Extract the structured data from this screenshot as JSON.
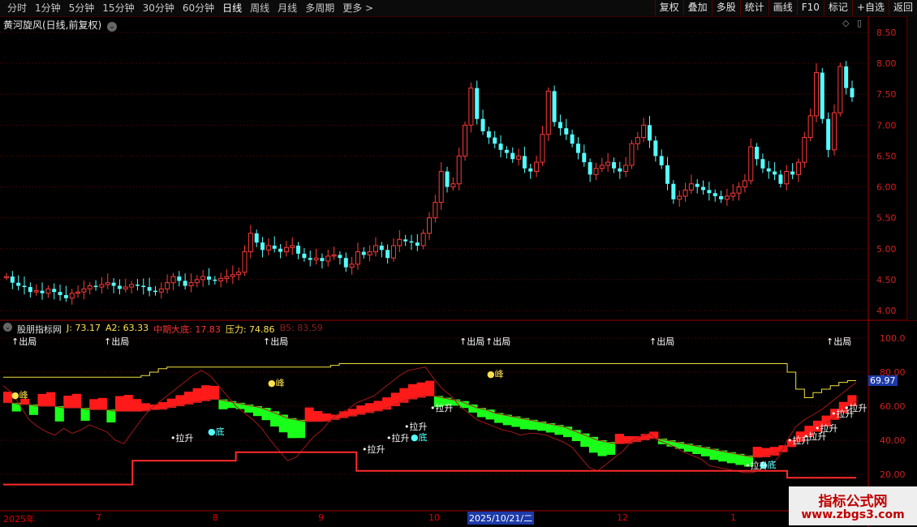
{
  "toolbar": {
    "periods": [
      "分时",
      "1分钟",
      "5分钟",
      "15分钟",
      "30分钟",
      "60分钟",
      "日线",
      "周线",
      "月线",
      "多周期",
      "更多 >"
    ],
    "active_period": "日线",
    "actions": [
      "复权",
      "叠加",
      "多股",
      "统计",
      "画线",
      "F10",
      "标记",
      "+自选",
      "返回"
    ]
  },
  "price_panel": {
    "title": "黄河旋风(日线,前复权)"
  },
  "indicator": {
    "name": "股朋指标网",
    "j": "J: 73.17",
    "a2": "A2: 63.33",
    "bottom": "中期大底: 17.83",
    "pressure": "压力: 74.86",
    "b5": "B5: 83.59",
    "last_value": "69.97",
    "signals": {
      "out": "↑出局",
      "peak": "●峰",
      "bottom": "●底",
      "lift": "•拉升"
    }
  },
  "dates": {
    "labels": [
      "2025年",
      "7",
      "8",
      "9",
      "10",
      "12",
      "1"
    ],
    "highlight": "2025/10/21/二"
  },
  "watermark": {
    "line1": "指标公式网",
    "line2": "www.zbgs3.com"
  },
  "chart_data": [
    {
      "type": "candlestick",
      "title": "黄河旋风(日线,前复权)",
      "y_ticks": [
        "8.50",
        "8.00",
        "7.50",
        "7.00",
        "6.50",
        "6.00",
        "5.50",
        "5.00",
        "4.50",
        "4.00"
      ],
      "ylim": [
        3.9,
        8.6
      ],
      "close": [
        4.55,
        4.45,
        4.4,
        4.38,
        4.3,
        4.32,
        4.28,
        4.35,
        4.3,
        4.25,
        4.2,
        4.28,
        4.3,
        4.35,
        4.4,
        4.38,
        4.42,
        4.45,
        4.4,
        4.35,
        4.38,
        4.42,
        4.4,
        4.38,
        4.32,
        4.3,
        4.35,
        4.45,
        4.55,
        4.48,
        4.4,
        4.45,
        4.5,
        4.55,
        4.5,
        4.48,
        4.52,
        4.55,
        4.58,
        4.62,
        4.95,
        5.25,
        5.1,
        4.98,
        5.05,
        5.0,
        4.95,
        5.02,
        5.05,
        4.92,
        4.85,
        4.82,
        4.85,
        4.8,
        4.88,
        4.9,
        4.85,
        4.7,
        4.75,
        4.95,
        4.9,
        4.95,
        5.05,
        4.98,
        4.85,
        5.05,
        5.15,
        5.12,
        5.1,
        5.05,
        5.25,
        5.5,
        5.75,
        6.25,
        6.0,
        6.05,
        6.5,
        7.0,
        7.6,
        7.1,
        6.9,
        6.8,
        6.7,
        6.6,
        6.55,
        6.45,
        6.5,
        6.3,
        6.25,
        6.4,
        6.85,
        7.55,
        7.05,
        6.95,
        6.85,
        6.7,
        6.55,
        6.4,
        6.2,
        6.3,
        6.35,
        6.4,
        6.3,
        6.25,
        6.35,
        6.7,
        6.8,
        7.0,
        6.75,
        6.5,
        6.35,
        6.05,
        5.8,
        5.85,
        5.95,
        6.05,
        6.0,
        5.95,
        5.9,
        5.85,
        5.8,
        5.85,
        5.9,
        6.0,
        6.1,
        6.65,
        6.45,
        6.3,
        6.25,
        6.2,
        6.05,
        6.25,
        6.2,
        6.4,
        6.8,
        7.15,
        7.85,
        7.1,
        6.6,
        7.2,
        7.95,
        7.6,
        7.45
      ]
    },
    {
      "type": "line",
      "title": "股朋指标网",
      "y_ticks": [
        "100.0",
        "80.00",
        "60.00",
        "40.00",
        "20.00"
      ],
      "ylim": [
        8,
        105
      ],
      "series": [
        {
          "name": "J",
          "values": [
            72,
            68,
            60,
            52,
            48,
            45,
            43,
            47,
            44,
            46,
            49,
            47,
            45,
            40,
            38,
            45,
            52,
            58,
            62,
            66,
            70,
            74,
            78,
            81,
            78,
            72,
            66,
            60,
            56,
            52,
            47,
            40,
            34,
            28,
            30,
            36,
            42,
            46,
            52,
            56,
            58,
            62,
            64,
            66,
            70,
            74,
            78,
            81,
            82,
            83,
            76,
            70,
            66,
            60,
            56,
            52,
            50,
            48,
            46,
            45,
            43,
            44,
            44,
            43,
            41,
            39,
            36,
            30,
            24,
            22,
            26,
            30,
            34,
            40,
            42,
            44,
            40,
            38,
            36,
            33,
            31,
            29,
            25,
            24,
            23,
            22,
            21,
            21,
            23,
            25,
            30,
            40,
            48,
            52,
            55,
            58,
            62,
            66,
            70,
            74
          ]
        },
        {
          "name": "A2",
          "values": [
            62,
            62,
            61,
            61,
            60,
            60,
            60,
            59,
            59,
            59,
            58,
            58,
            58,
            57,
            57,
            57,
            57,
            58,
            58,
            59,
            60,
            61,
            62,
            63,
            64,
            64,
            63,
            62,
            61,
            60,
            59,
            57,
            55,
            53,
            52,
            51,
            51,
            51,
            52,
            53,
            54,
            55,
            56,
            57,
            58,
            60,
            62,
            64,
            65,
            66,
            66,
            65,
            64,
            63,
            61,
            59,
            58,
            56,
            55,
            54,
            53,
            52,
            51,
            50,
            49,
            48,
            46,
            44,
            42,
            40,
            39,
            38,
            38,
            39,
            40,
            41,
            41,
            40,
            39,
            38,
            37,
            36,
            35,
            34,
            33,
            32,
            31,
            30,
            30,
            31,
            33,
            36,
            39,
            42,
            45,
            48,
            52,
            56,
            60,
            63
          ]
        },
        {
          "name": "压力",
          "values": [
            77,
            77,
            77,
            77,
            77,
            77,
            77,
            77,
            77,
            77,
            77,
            77,
            77,
            77,
            77,
            77,
            78,
            80,
            82,
            83,
            83,
            83,
            83,
            83,
            83,
            83,
            83,
            83,
            83,
            83,
            83,
            83,
            83,
            83,
            83,
            83,
            83,
            83,
            84,
            85,
            85,
            85,
            85,
            85,
            85,
            85,
            85,
            85,
            85,
            85,
            85,
            85,
            85,
            85,
            85,
            85,
            85,
            85,
            85,
            85,
            85,
            85,
            85,
            85,
            85,
            85,
            85,
            85,
            85,
            85,
            85,
            85,
            85,
            85,
            85,
            85,
            85,
            85,
            85,
            85,
            85,
            85,
            85,
            85,
            85,
            85,
            85,
            85,
            85,
            85,
            85,
            80,
            70,
            65,
            68,
            70,
            72,
            74,
            75,
            75
          ]
        },
        {
          "name": "中期大底",
          "values": [
            14,
            14,
            14,
            14,
            14,
            14,
            14,
            14,
            14,
            14,
            14,
            14,
            14,
            14,
            14,
            28,
            28,
            28,
            28,
            28,
            28,
            28,
            28,
            28,
            28,
            28,
            28,
            33,
            33,
            33,
            33,
            33,
            33,
            33,
            33,
            33,
            33,
            33,
            33,
            33,
            33,
            22,
            22,
            22,
            22,
            22,
            22,
            22,
            22,
            22,
            22,
            22,
            22,
            22,
            22,
            22,
            22,
            22,
            22,
            22,
            22,
            22,
            22,
            22,
            22,
            22,
            22,
            22,
            22,
            22,
            22,
            22,
            22,
            22,
            22,
            22,
            22,
            22,
            22,
            22,
            22,
            22,
            22,
            22,
            22,
            22,
            22,
            22,
            22,
            22,
            22,
            18,
            18,
            18,
            18,
            18,
            18,
            18,
            18,
            18
          ]
        }
      ]
    }
  ]
}
